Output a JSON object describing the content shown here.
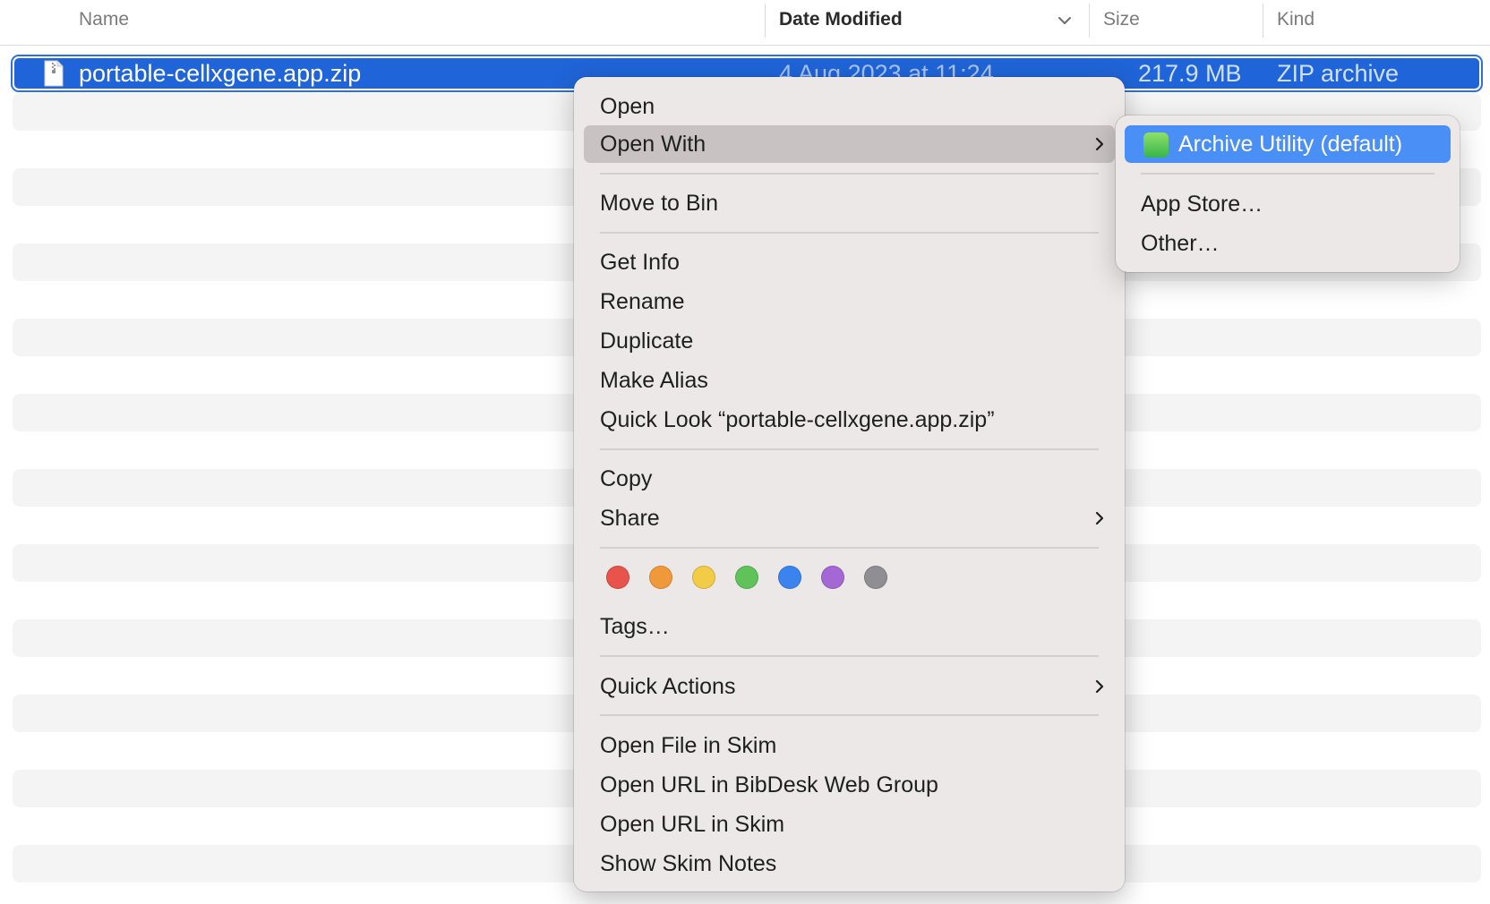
{
  "columns": {
    "name": "Name",
    "date_modified": "Date Modified",
    "size": "Size",
    "kind": "Kind"
  },
  "file": {
    "name": "portable-cellxgene.app.zip",
    "date_modified": "4 Aug 2023 at 11:24",
    "size": "217.9 MB",
    "kind": "ZIP archive"
  },
  "context_menu": {
    "open": "Open",
    "open_with": "Open With",
    "move_to_bin": "Move to Bin",
    "get_info": "Get Info",
    "rename": "Rename",
    "duplicate": "Duplicate",
    "make_alias": "Make Alias",
    "quick_look": "Quick Look “portable-cellxgene.app.zip”",
    "copy": "Copy",
    "share": "Share",
    "tags": "Tags…",
    "quick_actions": "Quick Actions",
    "open_file_in_skim": "Open File in Skim",
    "open_url_in_bibdesk": "Open URL in BibDesk Web Group",
    "open_url_in_skim": "Open URL in Skim",
    "show_skim_notes": "Show Skim Notes"
  },
  "tag_colors": {
    "red": "#e8534c",
    "orange": "#f0993a",
    "yellow": "#f2cc47",
    "green": "#5fc35a",
    "blue": "#3b84f0",
    "purple": "#a468d4",
    "gray": "#8e8e93"
  },
  "open_with_submenu": {
    "archive_utility": "Archive Utility (default)",
    "app_store": "App Store…",
    "other": "Other…"
  },
  "colors": {
    "selection": "#1f64d8",
    "submenu_highlight": "#4a8ff5",
    "menu_background": "#ece8e7"
  }
}
